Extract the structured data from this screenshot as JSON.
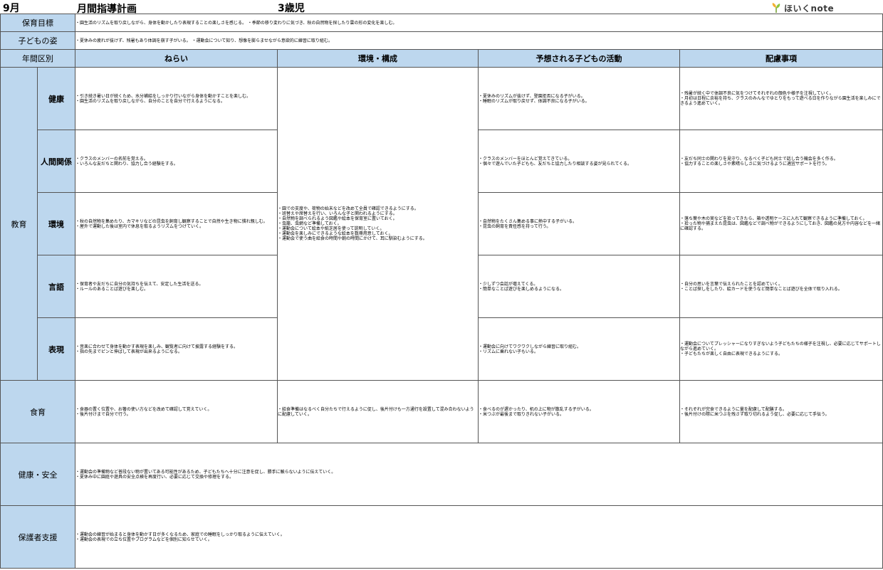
{
  "header": {
    "month": "9月",
    "title": "月間指導計画",
    "age": "3歳児",
    "logo_text": "ほいくnote"
  },
  "rows": {
    "goal_label": "保育目標",
    "goal_text": "・園生活のリズムを取り戻しながら、身体を動かしたり表現することの楽しさを感じる。 ・季節の移り変わりに気づき、秋の自然物を探したり雲の形の変化を楽しむ。",
    "child_label": "子どもの姿",
    "child_text": "・夏休みの疲れが抜けず、残暑もあり体調を崩す子がいる。 ・運動会について知り、想像を膨らませながら意欲的に練習に取り組む。"
  },
  "columns": {
    "period": "年間区別",
    "aim": "ねらい",
    "env": "環境・構成",
    "activity": "予想される子どもの活動",
    "care": "配慮事項"
  },
  "education": {
    "label": "教育",
    "env_shared": "・園での支度や、荷物の始末などを改めて全員で確認できるようにする。\n・班替えや席替えを行い、いろんな子と関われるようにする。\n・自然物を調べられるよう図鑑や絵本を保育室に置いておく。\n・虫籠、虫網など準備しておく。\n・運動会について絵本や紙芝居を使って説明していく。\n・運動会を楽しみにできるような絵本を数冊用意しておく。\n・運動会で使う曲を給食の時間や朝の時間にかけて、耳に馴染むようにする。",
    "areas": [
      {
        "label": "健康",
        "aim": "・引き続き暑い日が続くため、水分補給をしっかり行いながら身体を動かすことを楽しむ。\n・園生活のリズムを取り戻しながら、自分のことを自分で行えるようになる。",
        "activity": "・夏休みのリズムが抜けず、登園拒否になる子がいる。\n・睡眠のリズムが取り戻せず、体調不良になる子がいる。",
        "care": "・残暑が続く中で体調不良に気をつけてそれぞれの顔色や様子を注視していく。\n・月初は日程に余裕を持ち、クラスのみんなでゆとりをもって遊べる日を作りながら園生活を楽しみにできるよう進めていく。"
      },
      {
        "label": "人間関係",
        "aim": "・クラスのメンバーの名前を覚える。\n・いろんな友だちと関わり、協力し合う経験をする。",
        "activity": "・クラスのメンバーをほとんど覚えてきている。\n・個々で遊んでいた子どもも、友だちと協力したり相談する姿が見られてくる。",
        "care": "・友だち同士の関わりを見守り、なるべく子ども同士で話し合う機会を多く作る。\n・協力することの楽しさや素晴らしさに気づけるように適宜サポートを行う。"
      },
      {
        "label": "環境",
        "aim": "・秋の自然物を集めたり、カマキリなどの昆虫を飼育し観察することで自然や生き物に慣れ親しむ。\n・屋外で運動した後は室内で休息を取るようリズムをつけていく。",
        "activity": "・自然物をたくさん集める事に熱中する子がいる。\n・昆虫の飼育を責任感を持って行う。",
        "care": "・落ち葉や木の実などを拾ってきたら、箱や透明ケースに入れて観察できるように準備しておく。\n・拾った物や捕まえた昆虫は、図鑑などで調べ物ができるようにしておき、図鑑の見方や内容などを一緒に確認する。"
      },
      {
        "label": "言語",
        "aim": "・保育者や友だちに自分の気持ちを伝えて、安定した生活を送る。\n・ルールのあることば遊びを楽しむ。",
        "activity": "・少しずつ会話が増えてくる。\n・簡単なことば遊びを楽しめるようになる。",
        "care": "・自分の思いを言葉で伝えられたことを認めていく。\n・ことば探しをしたり、絵カードを使うなど簡単なことば遊びを全体で取り入れる。"
      },
      {
        "label": "表現",
        "aim": "・音楽に合わせて身体を動かす表現を楽しみ、観覧者に向けて披露する経験をする。\n・指の先までピンと伸ばして表現が出来るようになる。",
        "activity": "・運動会に向けてワクワクしながら練習に取り組む。\n・リズムに乗れない子もいる。",
        "care": "・運動会についてプレッシャーになりすぎないよう子どもたちの様子を注視し、必要に応じてサポートしながら進めていく。\n・子どもたちが楽しく自由に表現できるようにする。"
      }
    ]
  },
  "food": {
    "label": "食育",
    "aim": "・食器の置く位置や、お箸の使い方などを改めて確認して覚えていく。\n・後片付けまで自分で行う。",
    "env": "・給食準備はなるべく自分たちで行えるように促し、後片付けも一方通行を設置して混み合わないように配慮していく。",
    "activity": "・食べるのが遅かったり、机の上に物が散乱する子がいる。\n・米つぶが最後まで取りきれない子がいる。",
    "care": "・それぞれが完食できるように量を配慮して配膳する。\n・後片付けの際に米つぶを残さず取り切れるよう促し、必要に応じて手伝う。"
  },
  "safety": {
    "label": "健康・安全",
    "text": "・運動会の準備物など普段ない物が置いてある可能性があるため、子どもたちへ十分に注意を促し、勝手に触らないように伝えていく。\n・夏休み中に園庭や遊具の安全点検を再度行い、必要に応じて交換や修理をする。"
  },
  "parents": {
    "label": "保護者支援",
    "text": "・運動会の練習が始まると身体を動かす日が多くなるため、家庭での睡眠をしっかり取るように伝えていく。\n・運動会の表現での立ち位置やプログラムなどを個別に知らせていく。"
  }
}
